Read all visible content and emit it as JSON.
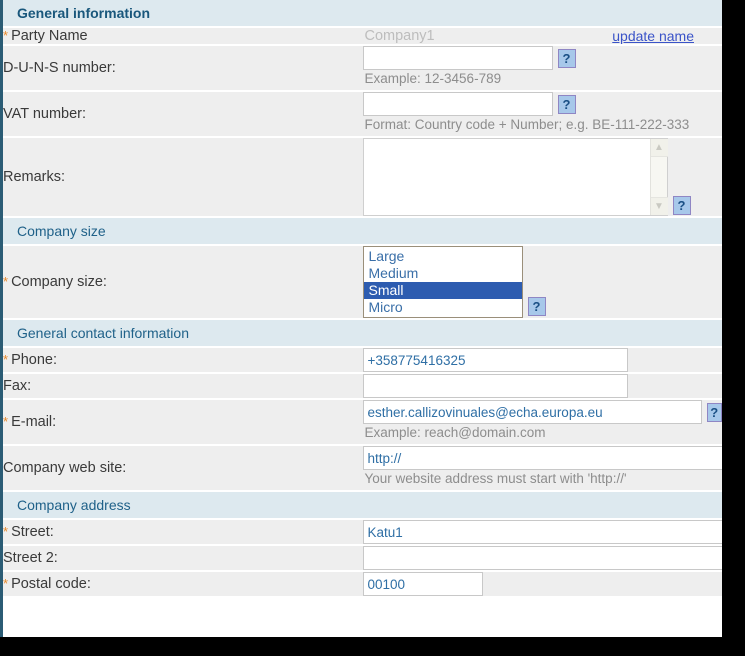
{
  "sections": {
    "general_information": "General information",
    "company_size": "Company size",
    "general_contact": "General contact information",
    "company_address": "Company address"
  },
  "required_marker": "*",
  "help_glyph": "?",
  "fields": {
    "party_name": {
      "label": "Party Name",
      "value": "Company1",
      "link_label": "update name"
    },
    "duns": {
      "label": "D-U-N-S number:",
      "value": "",
      "hint": "Example: 12-3456-789"
    },
    "vat": {
      "label": "VAT number:",
      "value": "",
      "hint": "Format: Country code + Number; e.g. BE-111-222-333"
    },
    "remarks": {
      "label": "Remarks:",
      "value": ""
    },
    "company_size": {
      "label": "Company size:",
      "options": [
        "Large",
        "Medium",
        "Small",
        "Micro"
      ],
      "selected": "Small"
    },
    "phone": {
      "label": "Phone:",
      "value": "+358775416325"
    },
    "fax": {
      "label": "Fax:",
      "value": ""
    },
    "email": {
      "label": "E-mail:",
      "value": "esther.callizovinuales@echa.europa.eu",
      "hint": "Example: reach@domain.com"
    },
    "website": {
      "label": "Company web site:",
      "value": "http://",
      "hint": "Your website address must start with 'http://'"
    },
    "street": {
      "label": "Street:",
      "value": "Katu1"
    },
    "street2": {
      "label": "Street 2:",
      "value": ""
    },
    "postal_code": {
      "label": "Postal code:",
      "value": "00100"
    }
  },
  "scrollbar": {
    "up_glyph": "▲",
    "down_glyph": "▼"
  },
  "colors": {
    "section_header_bg": "#dde9ef",
    "section_header_text": "#19577c",
    "row_bg": "#eeeeee",
    "required": "#e8892b",
    "input_text": "#2f6fa5",
    "hint_text": "#8d8d8d",
    "selection_bg": "#2d5cb0",
    "help_bg": "#a7c8ea",
    "link": "#3a53c8"
  }
}
